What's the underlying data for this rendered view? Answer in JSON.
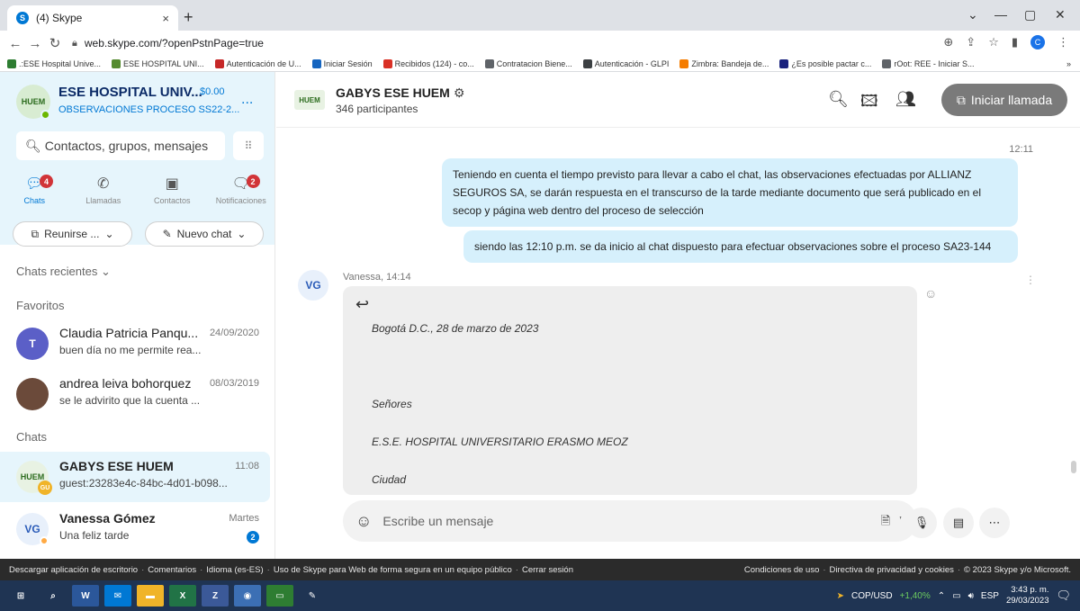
{
  "browser": {
    "tab_title": "(4) Skype",
    "tab_close": "×",
    "new_tab": "+",
    "url": "web.skype.com/?openPstnPage=true",
    "win_min": "—",
    "win_max": "▢",
    "win_close": "✕",
    "win_chevron": "⌄",
    "bookmarks": [
      {
        "label": ".:ESE Hospital Unive...",
        "color": "#2e7d32"
      },
      {
        "label": "ESE HOSPITAL UNI...",
        "color": "#558b2f"
      },
      {
        "label": "Autenticación de U...",
        "color": "#c62828"
      },
      {
        "label": "Iniciar Sesión",
        "color": "#1565c0"
      },
      {
        "label": "Recibidos (124) - co...",
        "color": "#d93025"
      },
      {
        "label": "Contratacion Biene...",
        "color": "#5f6368"
      },
      {
        "label": "Autenticación - GLPI",
        "color": "#3c4043"
      },
      {
        "label": "Zimbra: Bandeja de...",
        "color": "#f57c00"
      },
      {
        "label": "¿Es posible pactar c...",
        "color": "#1a237e"
      },
      {
        "label": "rOot: REE - Iniciar S...",
        "color": "#5f6368"
      }
    ],
    "bookmarks_more": "»"
  },
  "profile": {
    "org_name": "ESE HOSPITAL UNIV...",
    "credit": "$0.00",
    "subtitle": "OBSERVACIONES PROCESO SS22-2...",
    "more": "...",
    "initials": "C"
  },
  "search": {
    "placeholder": "Contactos, grupos, mensajes"
  },
  "nav": [
    {
      "label": "Chats",
      "badge": "4",
      "icon": "chat-icon"
    },
    {
      "label": "Llamadas",
      "badge": "",
      "icon": "phone-icon"
    },
    {
      "label": "Contactos",
      "badge": "",
      "icon": "contacts-icon"
    },
    {
      "label": "Notificaciones",
      "badge": "2",
      "icon": "bell-icon"
    }
  ],
  "actions": {
    "meet": "Reunirse ...",
    "new_chat": "Nuevo chat"
  },
  "sections": {
    "recent": "Chats recientes",
    "favorites": "Favoritos",
    "chats": "Chats"
  },
  "favorites": [
    {
      "name": "Claudia Patricia Panqu...",
      "time": "24/09/2020",
      "preview": "buen día no me permite rea..."
    },
    {
      "name": "andrea leiva bohorquez",
      "time": "08/03/2019",
      "preview": "se le advirito que la cuenta ..."
    }
  ],
  "chats": [
    {
      "name": "GABYS ESE HUEM",
      "time": "11:08",
      "preview": "guest:23283e4c-84bc-4d01-b098...",
      "tag": "GU"
    },
    {
      "name": "Vanessa Gómez",
      "time": "Martes",
      "preview": "Una feliz tarde",
      "initials": "VG",
      "unread": "2"
    }
  ],
  "conversation": {
    "title": "GABYS ESE HUEM",
    "participants": "346 participantes",
    "call_label": "Iniciar llamada",
    "time_header": "12:11",
    "messages_out": [
      "Teniendo en cuenta el tiempo previsto para llevar a cabo el chat, las observaciones efectuadas por ALLIANZ SEGUROS SA, se darán respuesta en el transcurso de la tarde mediante documento que será publicado en el secop y página web dentro del proceso de selección",
      "siendo las 12:10 p.m. se da inicio al chat dispuesto para efectuar observaciones sobre el proceso SA23-144"
    ],
    "incoming": {
      "initials": "VG",
      "sender": "Vanessa, 14:14",
      "lines": [
        "Bogotá D.C., 28 de marzo de 2023",
        "Señores",
        "E.S.E. HOSPITAL UNIVERSITARIO ERASMO MEOZ",
        "Ciudad"
      ]
    },
    "composer_placeholder": "Escribe un mensaje"
  },
  "footer": {
    "left": [
      "Descargar aplicación de escritorio",
      "Comentarios",
      "Idioma (es-ES)",
      "Uso de Skype para Web de forma segura en un equipo público",
      "Cerrar sesión"
    ],
    "right": [
      "Condiciones de uso",
      "Directiva de privacidad y cookies",
      "© 2023 Skype y/o Microsoft."
    ]
  },
  "taskbar": {
    "currency": "COP/USD",
    "change": "+1,40%",
    "lang": "ESP",
    "time": "3:43 p. m.",
    "date": "29/03/2023"
  },
  "colors": {
    "accent": "#0078d4",
    "badge": "#d13438",
    "bubble_out": "#d6f0fc",
    "sidebar_top": "#e6f5fc"
  }
}
